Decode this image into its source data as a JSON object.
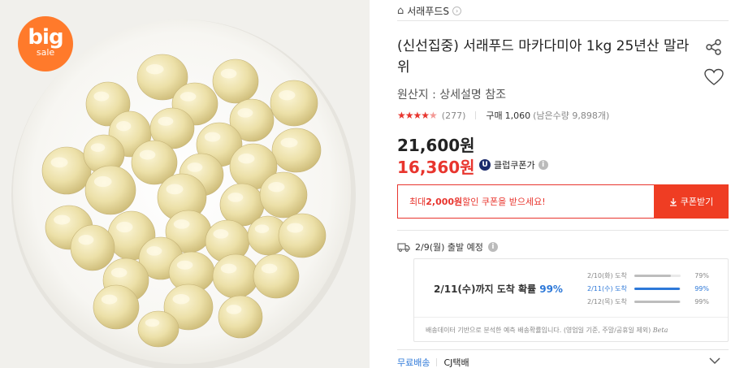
{
  "image": {
    "badge_big": "big",
    "badge_sale": "sale",
    "badge_color": "#ff7a2b"
  },
  "seller": {
    "name": "서래푸드S"
  },
  "product": {
    "title": "(신선집중) 서래푸드 마카다미아 1kg 25년산 말라위",
    "origin": "원산지 : 상세설명 참조"
  },
  "rating": {
    "stars": 4.5,
    "review_count": "(277)",
    "purchase_label": "구매",
    "purchase_count": "1,060",
    "stock": "(남은수량 9,898개)"
  },
  "price": {
    "original": "21,600원",
    "sale": "16,360원",
    "club_badge": "U",
    "club_label": "클럽쿠폰가"
  },
  "coupon": {
    "prefix": "최대 ",
    "amount": "2,000원",
    "suffix": " 할인 쿠폰을 받으세요!",
    "button": "쿠폰받기"
  },
  "shipping": {
    "date_label": "2/9(월) 출발 예정",
    "predict_main": "2/11(수)까지 도착 확률",
    "predict_pct": "99%",
    "rows": [
      {
        "label": "2/10(화) 도착",
        "value": "79%",
        "fill": 0.79
      },
      {
        "label": "2/11(수) 도착",
        "value": "99%",
        "fill": 0.99
      },
      {
        "label": "2/12(목) 도착",
        "value": "99%",
        "fill": 0.99
      }
    ],
    "note": "배송데이터 기반으로 분석한 예측 배송확률입니다. (영업일 기준, 주말/공휴일 제외)",
    "beta": "Beta",
    "free_label": "무료배송",
    "courier": "CJ택배"
  },
  "colors": {
    "accent_red": "#e8352e",
    "button_red": "#ef3d23",
    "blue": "#2d78d8"
  }
}
